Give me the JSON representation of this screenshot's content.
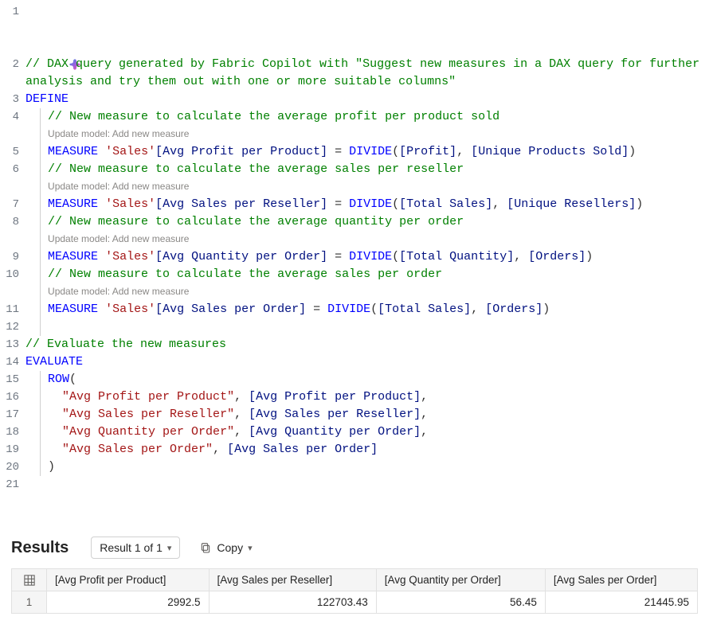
{
  "editor": {
    "lines": {
      "n1": "1",
      "n2": "2",
      "n3": "3",
      "n4": "4",
      "n5": "5",
      "n6": "6",
      "n7": "7",
      "n8": "8",
      "n9": "9",
      "n10": "10",
      "n11": "11",
      "n12": "12",
      "n13": "13",
      "n14": "14",
      "n15": "15",
      "n16": "16",
      "n17": "17",
      "n18": "18",
      "n19": "19",
      "n20": "20",
      "n21": "21"
    },
    "comment_top": "// DAX query generated by Fabric Copilot with \"Suggest new measures in a DAX query for further analysis and try them out with one or more suitable columns\"",
    "kw_define": "DEFINE",
    "hint_update": "Update model: Add new measure",
    "comment_m1": "// New measure to calculate the average profit per product sold",
    "comment_m2": "// New measure to calculate the average sales per reseller",
    "comment_m3": "// New measure to calculate the average quantity per order",
    "comment_m4": "// New measure to calculate the average sales per order",
    "kw_measure": "MEASURE",
    "tbl_sales": "'Sales'",
    "mcol1": "[Avg Profit per Product]",
    "mcol2": "[Avg Sales per Reseller]",
    "mcol3": "[Avg Quantity per Order]",
    "mcol4": "[Avg Sales per Order]",
    "fn_divide": "DIVIDE",
    "arg_profit": "[Profit]",
    "arg_upsold": "[Unique Products Sold]",
    "arg_tsales": "[Total Sales]",
    "arg_uresell": "[Unique Resellers]",
    "arg_tqty": "[Total Quantity]",
    "arg_orders": "[Orders]",
    "comment_eval": "// Evaluate the new measures",
    "kw_evaluate": "EVALUATE",
    "kw_row": "ROW",
    "s1": "\"Avg Profit per Product\"",
    "s2": "\"Avg Sales per Reseller\"",
    "s3": "\"Avg Quantity per Order\"",
    "s4": "\"Avg Sales per Order\""
  },
  "results": {
    "title": "Results",
    "selector": "Result 1 of 1",
    "copy_label": "Copy",
    "headers": [
      "[Avg Profit per Product]",
      "[Avg Sales per Reseller]",
      "[Avg Quantity per Order]",
      "[Avg Sales per Order]"
    ],
    "row_index": "1",
    "row": [
      "2992.5",
      "122703.43",
      "56.45",
      "21445.95"
    ]
  }
}
